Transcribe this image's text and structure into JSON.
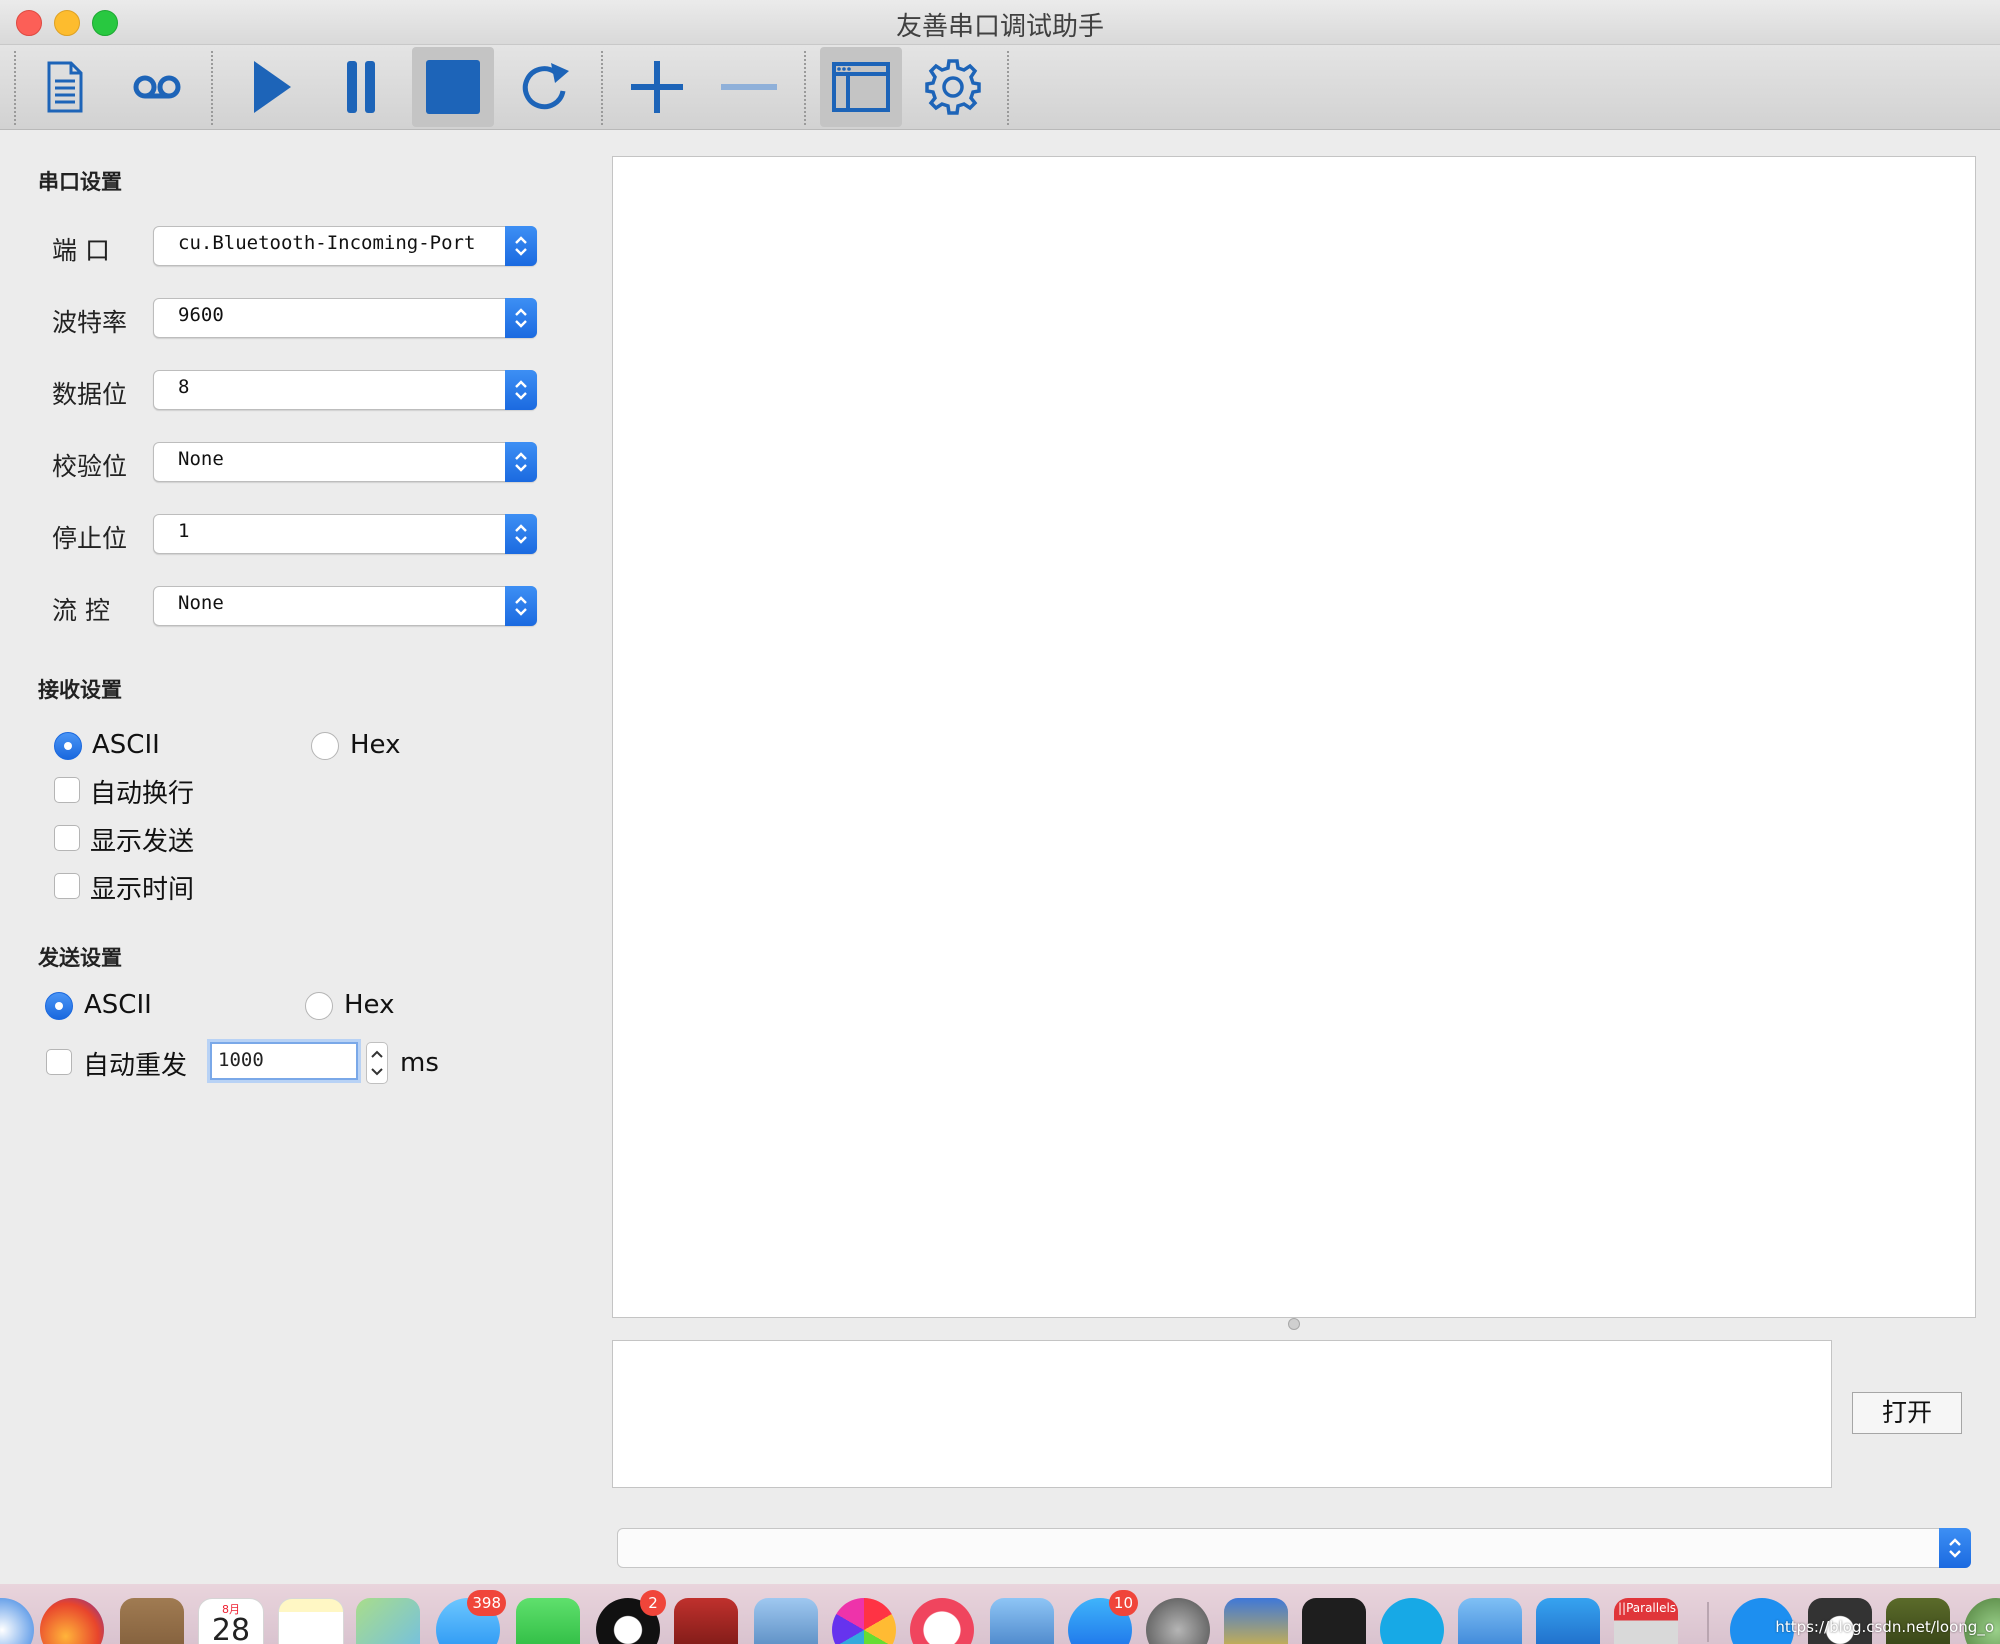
{
  "window": {
    "title": "友善串口调试助手"
  },
  "toolbar": {
    "items": [
      {
        "icon": "document-icon"
      },
      {
        "icon": "voicemail-icon"
      },
      {
        "icon": "play-icon"
      },
      {
        "icon": "pause-icon"
      },
      {
        "icon": "stop-icon"
      },
      {
        "icon": "refresh-icon"
      },
      {
        "icon": "plus-icon"
      },
      {
        "icon": "minus-icon"
      },
      {
        "icon": "window-icon"
      },
      {
        "icon": "gear-icon"
      }
    ]
  },
  "serial_settings": {
    "title": "串口设置",
    "fields": [
      {
        "label": "端 口",
        "value": "cu.Bluetooth-Incoming-Port"
      },
      {
        "label": "波特率",
        "value": "9600"
      },
      {
        "label": "数据位",
        "value": "8"
      },
      {
        "label": "校验位",
        "value": "None"
      },
      {
        "label": "停止位",
        "value": "1"
      },
      {
        "label": "流 控",
        "value": "None"
      }
    ]
  },
  "receive_settings": {
    "title": "接收设置",
    "mode_ascii": "ASCII",
    "mode_hex": "Hex",
    "selected_mode": "ASCII",
    "options": [
      {
        "label": "自动换行",
        "checked": false
      },
      {
        "label": "显示发送",
        "checked": false
      },
      {
        "label": "显示时间",
        "checked": false
      }
    ]
  },
  "send_settings": {
    "title": "发送设置",
    "mode_ascii": "ASCII",
    "mode_hex": "Hex",
    "selected_mode": "ASCII",
    "auto_resend_label": "自动重发",
    "auto_resend_checked": false,
    "interval_value": "1000",
    "interval_unit": "ms"
  },
  "main": {
    "open_button": "打开"
  },
  "dock": {
    "badges": {
      "messages": "398",
      "qq": "2",
      "app_store": "10"
    },
    "calendar_month": "8月",
    "calendar_day": "28",
    "parallels_label": "||Parallels"
  },
  "watermark": "https://blog.csdn.net/loong_o"
}
